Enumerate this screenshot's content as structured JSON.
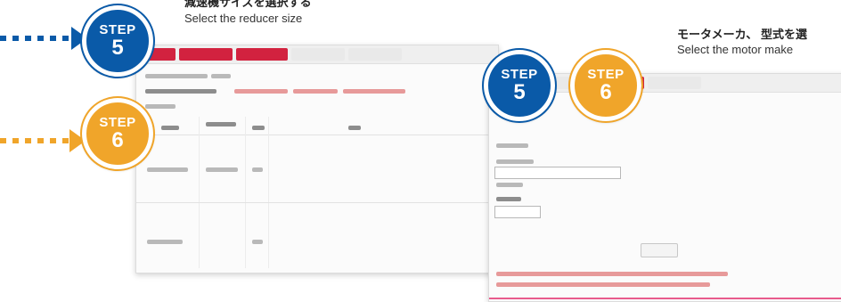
{
  "steps": [
    {
      "label": "STEP",
      "number": "5",
      "color": "#0a5aa8"
    },
    {
      "label": "STEP",
      "number": "6",
      "color": "#f0a52a"
    }
  ],
  "captions": {
    "step5_jp": "減速機サイズを選択する",
    "step5_en": "Select the reducer size",
    "step6_jp": "モータメーカ、 型式を選",
    "step6_en": "Select the motor make"
  },
  "colors": {
    "step5_blue": "#0a5aa8",
    "step6_orange": "#f0a52a",
    "tab_red": "#c8102e",
    "accent_pink": "#e85b8c"
  },
  "icons": [
    "dotted-arrow-right-icon"
  ]
}
